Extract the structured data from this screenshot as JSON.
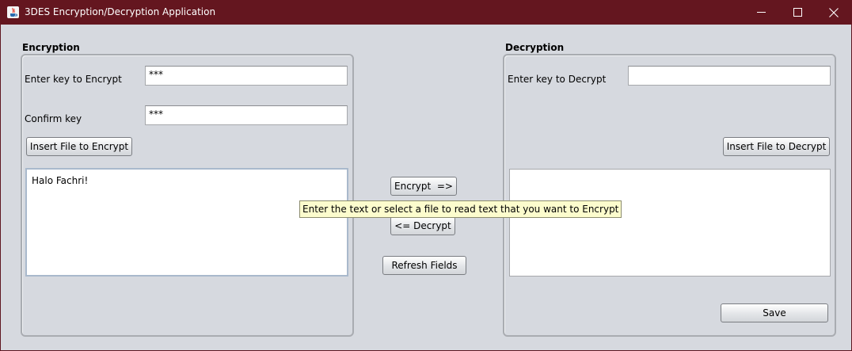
{
  "window": {
    "title": "3DES Encryption/Decryption Application",
    "icon": "java-icon",
    "controls": {
      "minimize": "—",
      "maximize": "☐",
      "close": "✕"
    }
  },
  "encryption": {
    "section_title": "Encryption",
    "key_label": "Enter key to Encrypt",
    "key_value": "***",
    "confirm_label": "Confirm key",
    "confirm_value": "***",
    "insert_button": "Insert File to Encrypt",
    "text": "Halo Fachri!"
  },
  "middle": {
    "encrypt_button": "Encrypt  =>",
    "decrypt_button": "<= Decrypt",
    "refresh_button": "Refresh Fields"
  },
  "tooltip": {
    "text": "Enter the text or select a file to read text that you want to Encrypt"
  },
  "decryption": {
    "section_title": "Decryption",
    "key_label": "Enter key to Decrypt",
    "key_value": "",
    "insert_button": "Insert File to Decrypt",
    "text": "",
    "save_button": "Save"
  },
  "colors": {
    "titlebar": "#64161f",
    "background": "#d6d9df",
    "tooltip": "#fcfccd"
  }
}
